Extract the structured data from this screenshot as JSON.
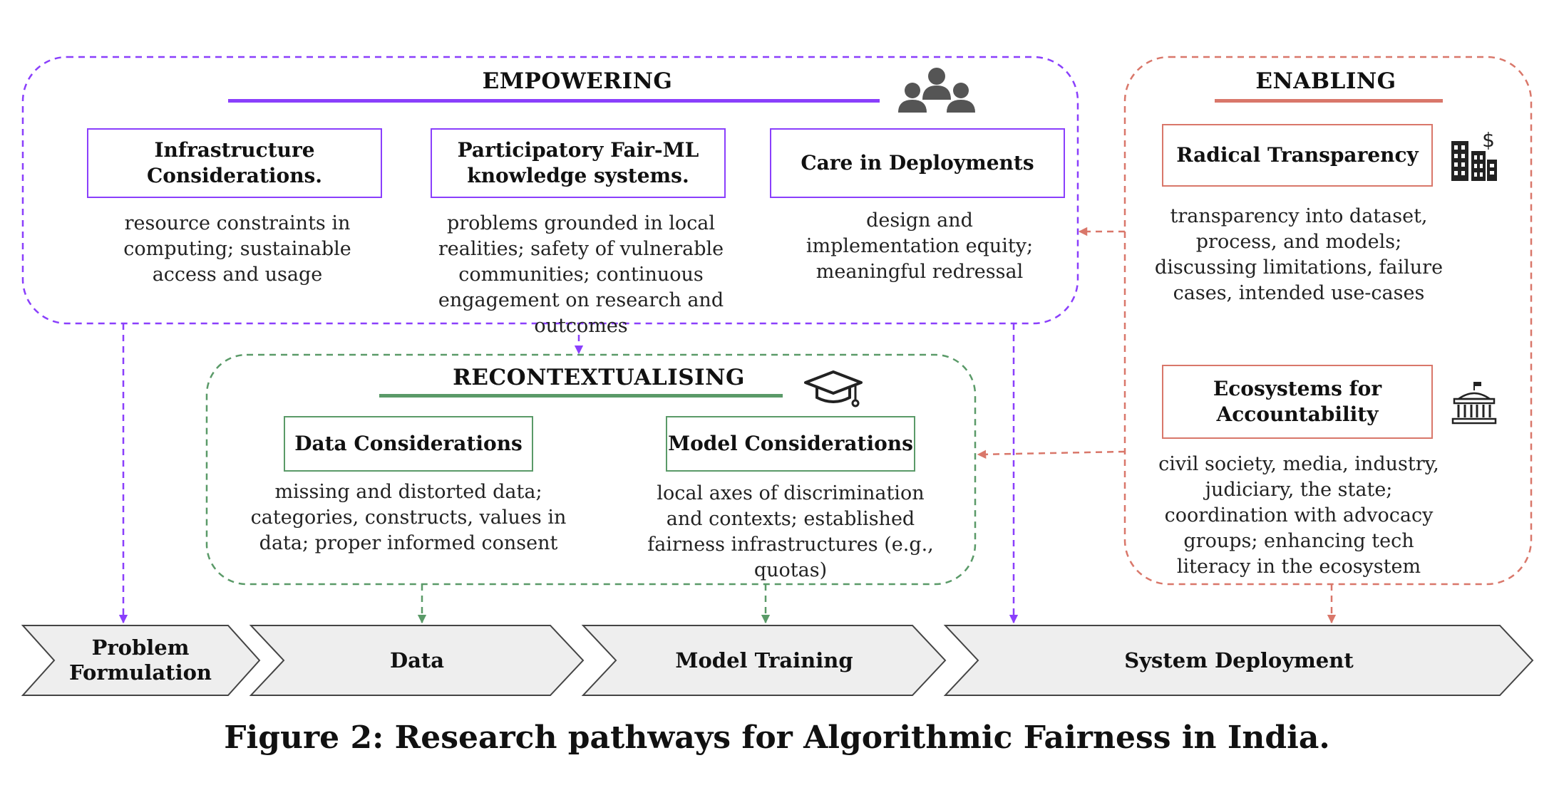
{
  "caption": "Figure 2: Research pathways for Algorithmic Fairness in India.",
  "colors": {
    "empowering": "#8a3ffc",
    "recontextualising": "#5a9a68",
    "enabling": "#d9776a",
    "stage_fill": "#eeeeee"
  },
  "empowering": {
    "title": "EMPOWERING",
    "icon": "people-group-icon",
    "boxes": [
      {
        "title": "Infrastructure Considerations.",
        "desc": "resource constraints in computing; sustainable access and usage"
      },
      {
        "title": "Participatory Fair-ML knowledge systems.",
        "desc": "problems grounded in local realities; safety of vulnerable communities; continuous engagement on research and outcomes"
      },
      {
        "title": "Care in Deployments",
        "desc": "design and implementation equity; meaningful redressal"
      }
    ]
  },
  "recontextualising": {
    "title": "RECONTEXTUALISING",
    "icon": "graduation-cap-icon",
    "boxes": [
      {
        "title": "Data Considerations",
        "desc": "missing and distorted data; categories, constructs, values in data; proper informed consent"
      },
      {
        "title": "Model Considerations",
        "desc": "local axes of discrimination and contexts; established fairness infrastructures (e.g., quotas)"
      }
    ]
  },
  "enabling": {
    "title": "ENABLING",
    "boxes": [
      {
        "title": "Radical Transparency",
        "icon": "buildings-money-icon",
        "desc": "transparency into dataset, process, and models; discussing limitations, failure cases, intended use-cases"
      },
      {
        "title": "Ecosystems for Accountability",
        "icon": "government-building-icon",
        "desc": "civil society, media, industry, judiciary, the state; coordination with advocacy groups; enhancing tech literacy in the ecosystem"
      }
    ]
  },
  "stages": [
    "Problem Formulation",
    "Data",
    "Model Training",
    "System Deployment"
  ]
}
